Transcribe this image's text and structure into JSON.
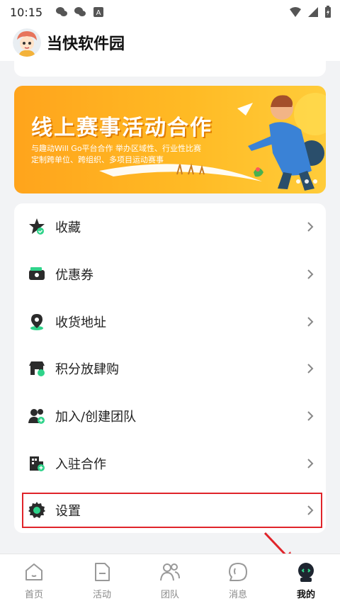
{
  "status_bar": {
    "time": "10:15"
  },
  "header": {
    "title": "当快软件园"
  },
  "banner": {
    "title": "线上赛事活动合作",
    "subtitle_line1": "与趣动Will Go平台合作 举办区域性、行业性比赛",
    "subtitle_line2": "定制跨单位、跨组织、多项目运动赛事"
  },
  "menu": {
    "items": [
      {
        "label": "收藏",
        "icon": "star-icon"
      },
      {
        "label": "优惠券",
        "icon": "coupon-icon"
      },
      {
        "label": "收货地址",
        "icon": "location-pin-icon"
      },
      {
        "label": "积分放肆购",
        "icon": "shop-icon"
      },
      {
        "label": "加入/创建团队",
        "icon": "add-team-icon"
      },
      {
        "label": "入驻合作",
        "icon": "building-icon"
      },
      {
        "label": "设置",
        "icon": "gear-icon"
      }
    ]
  },
  "tab_bar": {
    "tabs": [
      {
        "label": "首页",
        "icon": "home-icon",
        "active": false
      },
      {
        "label": "活动",
        "icon": "activity-icon",
        "active": false
      },
      {
        "label": "团队",
        "icon": "team-icon",
        "active": false
      },
      {
        "label": "消息",
        "icon": "message-icon",
        "active": false
      },
      {
        "label": "我的",
        "icon": "profile-robot-icon",
        "active": true
      }
    ]
  },
  "colors": {
    "accent_green": "#2fd38a",
    "banner_orange": "#ffa41c",
    "highlight_red": "#e0242a"
  }
}
